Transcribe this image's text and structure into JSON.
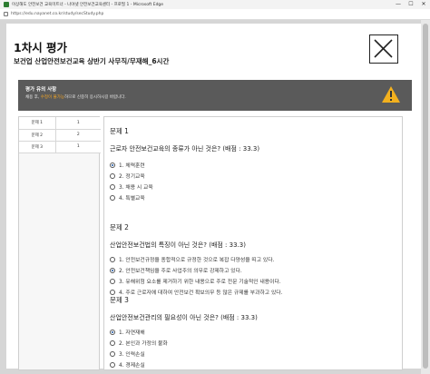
{
  "window": {
    "title": "이상해도 안전보건 교육미트너 - 나야넷 안전보건교육센터 - 프로필 1 - Microsoft Edge",
    "minimize": "—",
    "maximize": "☐",
    "close": "✕"
  },
  "address": {
    "url": "https://edu.nayanet.co.kr/study/secStudy.php"
  },
  "header": {
    "title": "1차시 평가",
    "subtitle": "보건업 산업안전보건교육 상반기 사무직/무재해_6시간",
    "close_label": "close"
  },
  "notice": {
    "title": "평가 유의 사항",
    "text_before": "채용 후, ",
    "text_highlight": "수정이 불가능",
    "text_after": "하므로 신중히 응시하시길 바랍니다."
  },
  "nav": {
    "rows": [
      {
        "q": "문제 1",
        "a": "1"
      },
      {
        "q": "문제 2",
        "a": "2"
      },
      {
        "q": "문제 3",
        "a": "1"
      }
    ]
  },
  "questions": [
    {
      "head": "문제 1",
      "text": "근로자 안전보건교육의 종류가 아닌 것은? (배점 : 33.3)",
      "options": [
        "1. 체력훈련",
        "2. 정기교육",
        "3. 채용 시 교육",
        "4. 특별교육"
      ],
      "selected": 0
    },
    {
      "head": "문제 2",
      "text": "산업안전보건법의 특징이 아닌 것은? (배점 : 33.3)",
      "options": [
        "1. 안전보건규정을 종합적으로 규정한 것으로 복잡 다양성을 띠고 있다.",
        "2. 안전보건책임을 주로 사업주의 의무로 강제하고 있다.",
        "3. 유해위험 요소를 제거하기 위한 내용으로 주로 전문 기술적인 내용이다.",
        "4. 주로 근로자에 대하여 안전보건 확보의무 등 많은 규제를 부과하고 있다."
      ],
      "selected": 1
    },
    {
      "head": "문제 3",
      "text": "산업안전보건관리의 필요성이 아닌 것은? (배점 : 33.3)",
      "options": [
        "1. 자연재해",
        "2. 본인과 가정의 불화",
        "3. 인력손실",
        "4. 경제손실"
      ],
      "selected": 0
    }
  ]
}
